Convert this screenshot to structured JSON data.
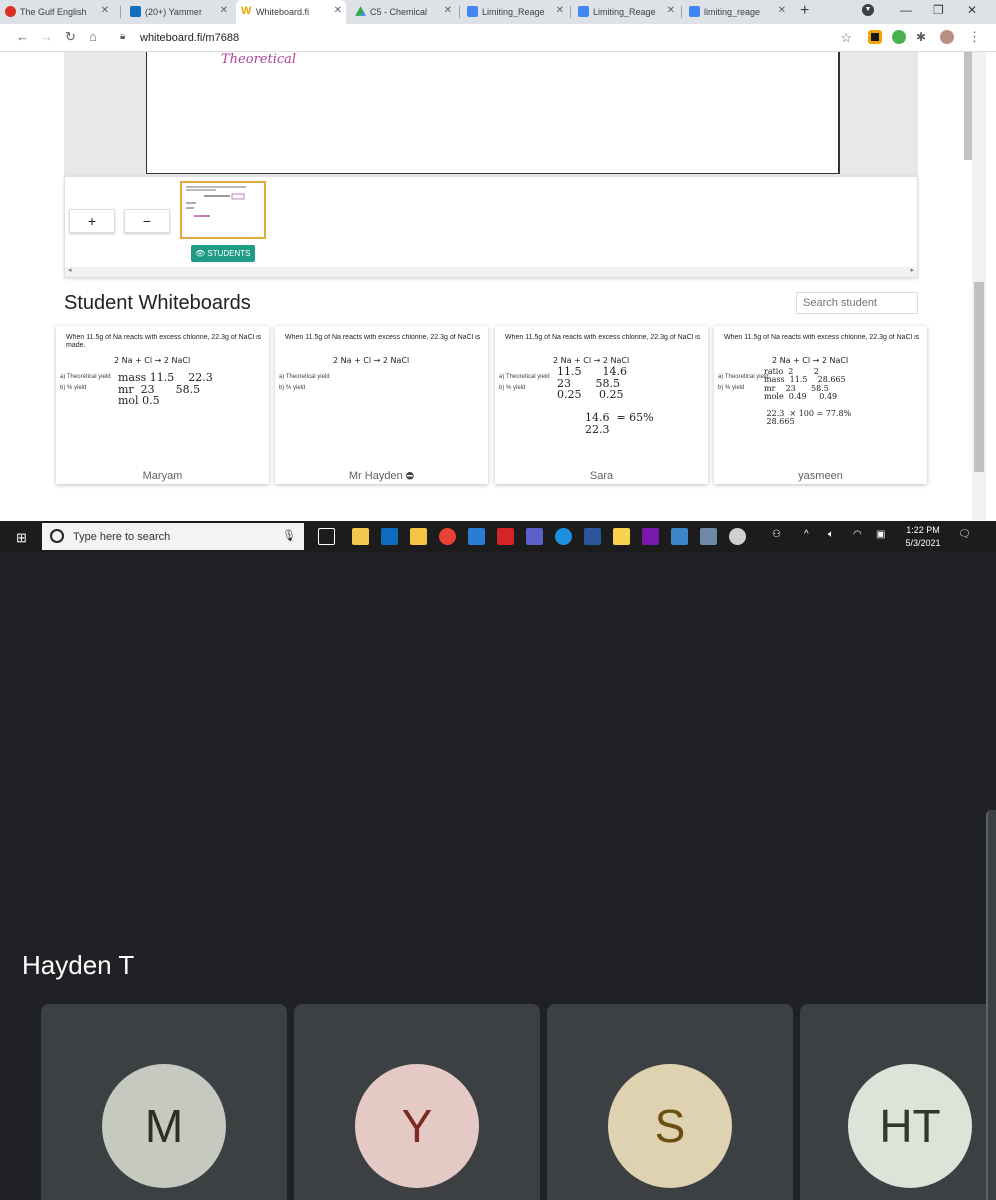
{
  "browser": {
    "tabs": [
      {
        "label": "The Gulf English",
        "color": "#d93025"
      },
      {
        "label": "(20+) Yammer",
        "color": "#106ebe"
      },
      {
        "label": "Whiteboard.fi",
        "color": "#e8a400",
        "active": true
      },
      {
        "label": "C5 - Chemical",
        "color": "#34a853"
      },
      {
        "label": "Limiting_Reage",
        "color": "#4285f4"
      },
      {
        "label": "Limiting_Reage",
        "color": "#4285f4"
      },
      {
        "label": "limiting_reage",
        "color": "#4285f4"
      }
    ],
    "url": "whiteboard.fi/m7688"
  },
  "whiteboard": {
    "scribble": "Theoretical",
    "zoom_in": "+",
    "zoom_out": "−",
    "students_button": "STUDENTS"
  },
  "student_section": {
    "title": "Student Whiteboards",
    "search_placeholder": "Search student"
  },
  "question": "When 11.5g of Na reacts with excess chlorine, 22.3g of NaCl is made.",
  "equation": "2 Na + Cl → 2 NaCl",
  "labels": {
    "a": "a) Theoretical yield",
    "b": "b) % yield"
  },
  "cards": [
    {
      "name": "Maryam",
      "work": "mass 11.5    22.3\nmr  23      58.5\nmol 0.5"
    },
    {
      "name": "Mr Hayden",
      "work": ""
    },
    {
      "name": "Sara",
      "work": "11.5      14.6\n23       58.5\n0.25     0.25\n\n        14.6  = 65%\n        22.3"
    },
    {
      "name": "yasmeen",
      "work": "ratio  2        2\nmass  11.5    28.665\nmr    23      58.5\nmole  0.49     0.49\n\n 22.3  × 100 = 77.8%\n 28.665"
    }
  ],
  "taskbar": {
    "search_placeholder": "Type here to search",
    "time": "1:22 PM",
    "date": "5/3/2021"
  },
  "meeting": {
    "presenter": "Hayden T",
    "participants": [
      {
        "initials": "M",
        "bg": "#c5c9c0",
        "fg": "#2b2f26"
      },
      {
        "initials": "Y",
        "bg": "#e5c9c5",
        "fg": "#7a2a20"
      },
      {
        "initials": "S",
        "bg": "#dfd2b0",
        "fg": "#6b4e12"
      },
      {
        "initials": "HT",
        "bg": "#dde3d8",
        "fg": "#2f3a2a"
      }
    ]
  }
}
